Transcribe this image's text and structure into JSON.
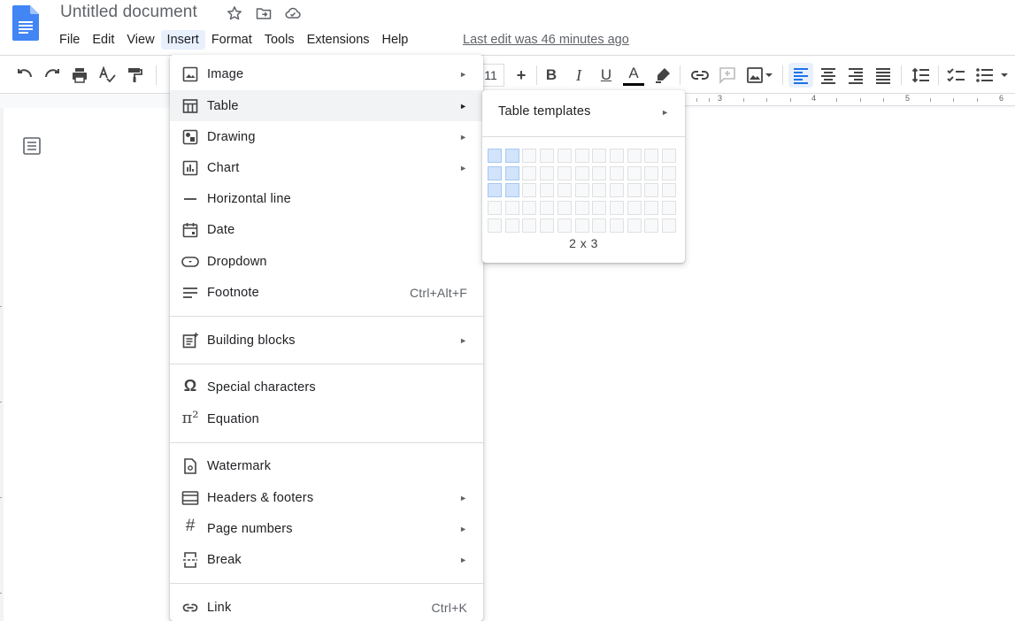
{
  "app": {
    "doc_title": "Untitled document",
    "last_edit": "Last edit was 46 minutes ago"
  },
  "menubar": {
    "items": [
      "File",
      "Edit",
      "View",
      "Insert",
      "Format",
      "Tools",
      "Extensions",
      "Help"
    ],
    "active": "Insert"
  },
  "toolbar": {
    "font_size": "11",
    "font_size_plus": "+",
    "bold": "B",
    "italic": "I",
    "underline": "U",
    "text_color": "A"
  },
  "ruler": {
    "labels": [
      "3",
      "4",
      "5",
      "6"
    ]
  },
  "insert_menu": {
    "items": [
      {
        "label": "Image",
        "icon": "image-icon",
        "submenu": true
      },
      {
        "label": "Table",
        "icon": "table-icon",
        "submenu": true
      },
      {
        "label": "Drawing",
        "icon": "drawing-icon",
        "submenu": true
      },
      {
        "label": "Chart",
        "icon": "chart-icon",
        "submenu": true
      },
      {
        "label": "Horizontal line",
        "icon": "horizontal-line-icon",
        "submenu": false
      },
      {
        "label": "Date",
        "icon": "calendar-icon",
        "submenu": false
      },
      {
        "label": "Dropdown",
        "icon": "dropdown-icon",
        "submenu": false
      },
      {
        "label": "Footnote",
        "icon": "footnote-icon",
        "shortcut": "Ctrl+Alt+F"
      },
      {
        "label": "Building blocks",
        "icon": "building-blocks-icon",
        "submenu": true
      },
      {
        "label": "Special characters",
        "icon": "omega-icon",
        "submenu": false
      },
      {
        "label": "Equation",
        "icon": "pi-icon",
        "submenu": false
      },
      {
        "label": "Watermark",
        "icon": "watermark-icon",
        "submenu": false
      },
      {
        "label": "Headers & footers",
        "icon": "headers-footers-icon",
        "submenu": true
      },
      {
        "label": "Page numbers",
        "icon": "hash-icon",
        "submenu": true
      },
      {
        "label": "Break",
        "icon": "break-icon",
        "submenu": true
      },
      {
        "label": "Link",
        "icon": "link-icon",
        "shortcut": "Ctrl+K"
      }
    ],
    "hovered": "Table"
  },
  "table_submenu": {
    "templates_label": "Table templates",
    "grid_cols": 11,
    "grid_rows": 5,
    "selected_cols": 2,
    "selected_rows": 3,
    "size_label": "2 x 3"
  },
  "colors": {
    "accent": "#1a73e8",
    "hover": "#f1f3f4",
    "selected_cell": "#d2e3fc",
    "active_menu": "#e8f0fe"
  }
}
